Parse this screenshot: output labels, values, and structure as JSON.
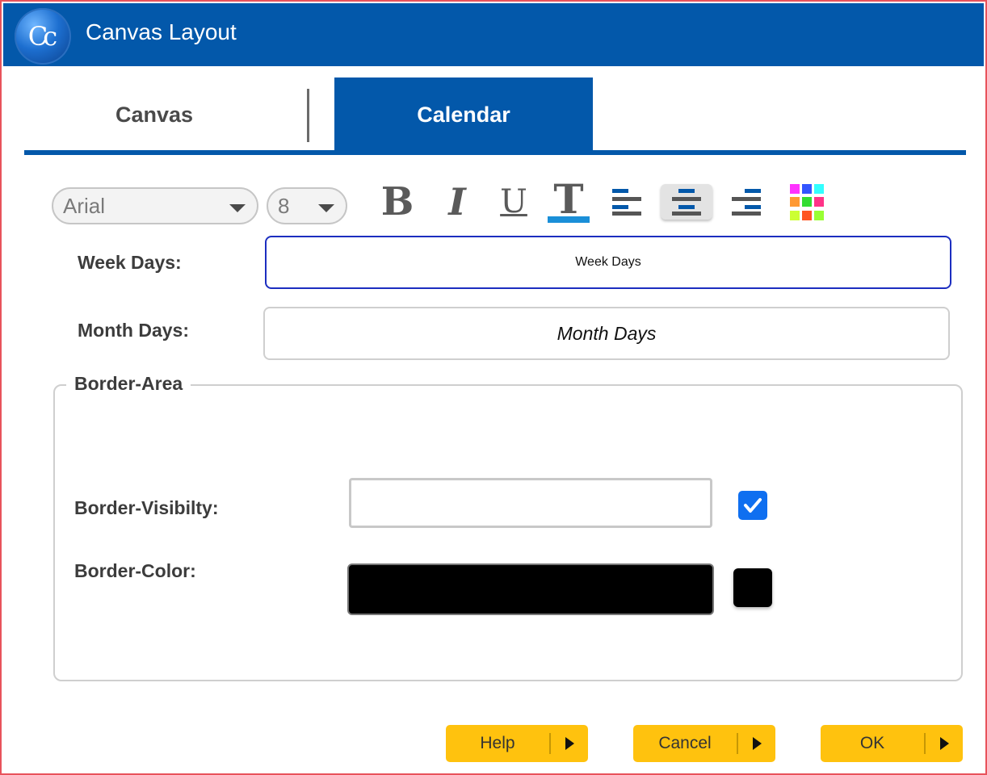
{
  "window": {
    "title": "Canvas Layout",
    "logo_text": "Cc",
    "border_color": "#e8535b"
  },
  "tabs": [
    {
      "label": "Canvas",
      "active": false
    },
    {
      "label": "Calendar",
      "active": true
    }
  ],
  "toolbar": {
    "font_family": "Arial",
    "font_size": "8",
    "bold_glyph": "B",
    "italic_glyph": "I",
    "underline_glyph": "U",
    "text_color_glyph": "T",
    "align_active": "center",
    "icons": [
      "bold-icon",
      "italic-icon",
      "underline-icon",
      "text-color-icon",
      "align-left-icon",
      "align-center-icon",
      "align-right-icon",
      "color-palette-icon"
    ]
  },
  "fields": {
    "week_days_label": "Week Days:",
    "week_days_value": "Week Days",
    "month_days_label": "Month Days:",
    "month_days_value": "Month Days"
  },
  "border_area": {
    "legend": "Border-Area",
    "visibility_label": "Border-Visibilty:",
    "visibility_checked": true,
    "color_label": "Border-Color:",
    "color_value": "#000000"
  },
  "buttons": {
    "help": "Help",
    "cancel": "Cancel",
    "ok": "OK"
  },
  "colors": {
    "brand_blue": "#0358aa",
    "button_yellow": "#ffc20e",
    "checkbox_blue": "#0f6ff0"
  }
}
